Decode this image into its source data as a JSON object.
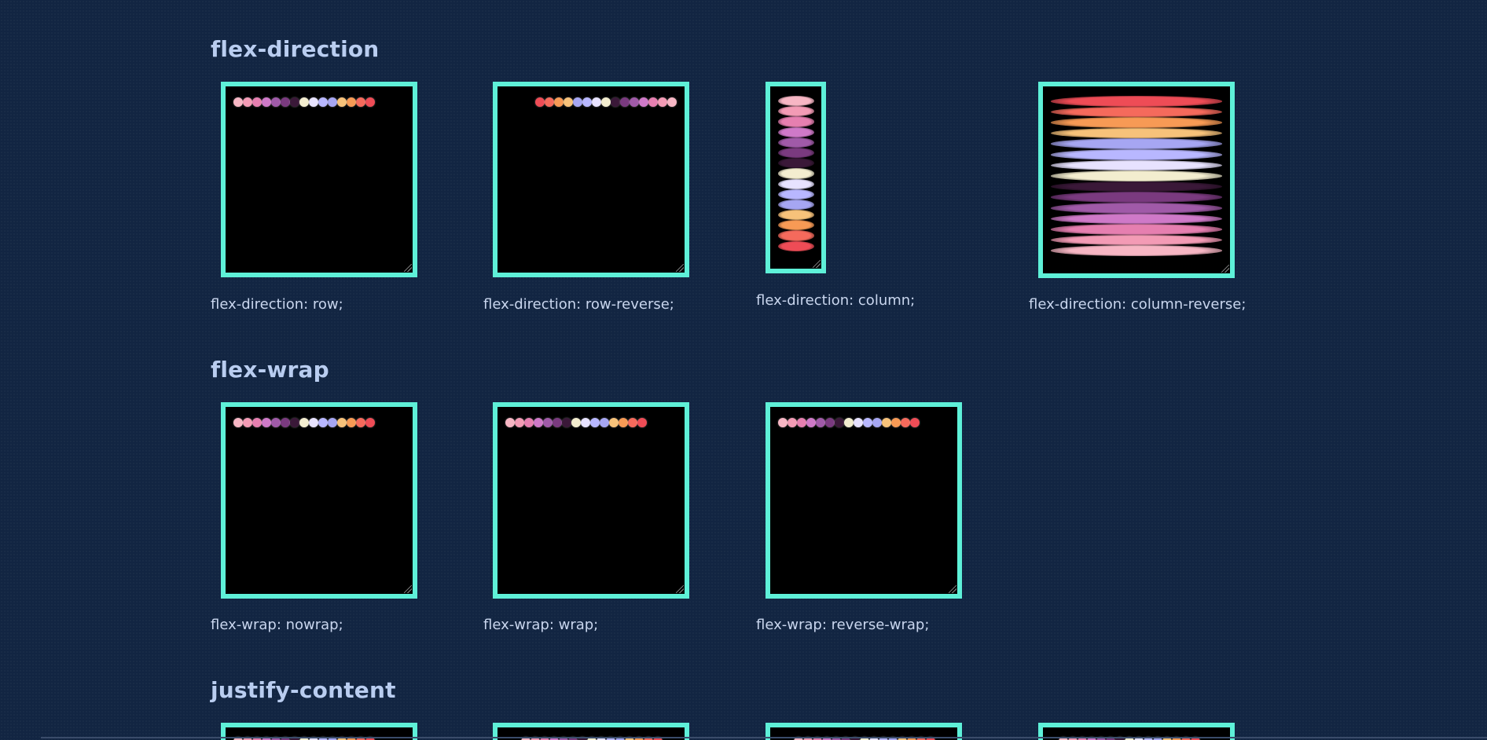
{
  "sections": [
    {
      "title": "flex-direction",
      "demos": [
        {
          "caption": "flex-direction: row;"
        },
        {
          "caption": "flex-direction: row-reverse;"
        },
        {
          "caption": "flex-direction: column;"
        },
        {
          "caption": "flex-direction: column-reverse;"
        }
      ]
    },
    {
      "title": "flex-wrap",
      "demos": [
        {
          "caption": "flex-wrap: nowrap;"
        },
        {
          "caption": "flex-wrap: wrap;"
        },
        {
          "caption": "flex-wrap: reverse-wrap;"
        }
      ]
    },
    {
      "title": "justify-content",
      "demos": []
    }
  ],
  "colors": {
    "background": "#122542",
    "box_border": "#5ef0d8",
    "box_fill": "#000000",
    "dot_palette": [
      "#f7b6c4",
      "#f39bb5",
      "#e67fb0",
      "#cf79c8",
      "#a05aa8",
      "#7a3a7f",
      "#3a1838",
      "#f3edcf",
      "#e7e2ff",
      "#b8b7ff",
      "#a6a6f2",
      "#f7c27a",
      "#f79a55",
      "#f56a5c",
      "#ee4c56"
    ]
  }
}
